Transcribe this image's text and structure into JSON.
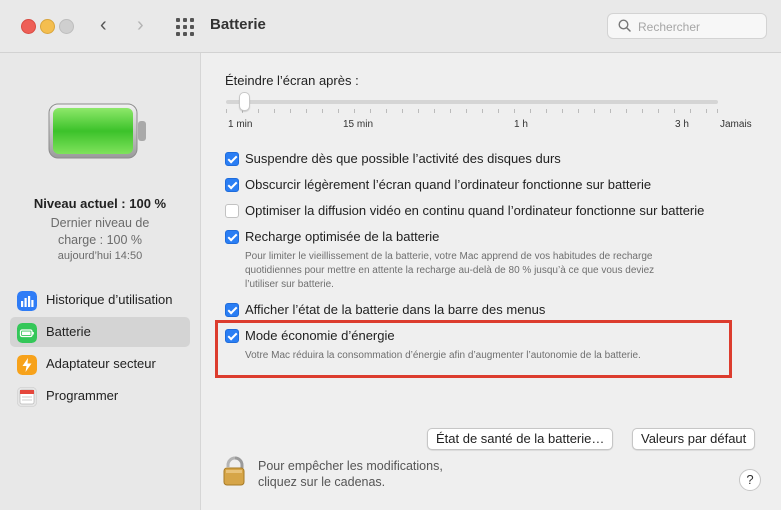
{
  "window": {
    "title": "Batterie"
  },
  "search": {
    "placeholder": "Rechercher"
  },
  "sidebar": {
    "level_main": "Niveau actuel : 100 %",
    "level_sub": "Dernier niveau de charge : 100 %",
    "level_time": "aujourd’hui 14:50",
    "items": [
      {
        "label": "Historique d’utilisation",
        "icon": "chart-icon",
        "color": "#2f7cf6"
      },
      {
        "label": "Batterie",
        "icon": "battery-icon",
        "color": "#34c759"
      },
      {
        "label": "Adaptateur secteur",
        "icon": "lightning-icon",
        "color": "#f7a21b"
      },
      {
        "label": "Programmer",
        "icon": "calendar-icon",
        "color": "#e5e5e5"
      }
    ],
    "selected": "Batterie"
  },
  "main": {
    "slider_label": "Éteindre l’écran après :",
    "slider_value": "1 min",
    "ticks": [
      "1 min",
      "15 min",
      "1 h",
      "3 h",
      "Jamais"
    ],
    "options": [
      {
        "label": "Suspendre dès que possible l’activité des disques durs",
        "checked": true
      },
      {
        "label": "Obscurcir légèrement l’écran quand l’ordinateur fonctionne sur batterie",
        "checked": true
      },
      {
        "label": "Optimiser la diffusion vidéo en continu quand l’ordinateur fonctionne sur batterie",
        "checked": false
      },
      {
        "label": "Recharge optimisée de la batterie",
        "checked": true,
        "description": [
          "Pour limiter le vieillissement de la batterie, votre Mac apprend de vos habitudes de recharge",
          "quotidiennes pour mettre en attente la recharge au-delà de 80 % jusqu’à ce que vous deviez",
          "l’utiliser sur batterie."
        ]
      },
      {
        "label": "Afficher l’état de la batterie dans la barre des menus",
        "checked": true
      },
      {
        "label": "Mode économie d’énergie",
        "checked": true,
        "description": [
          "Votre Mac réduira la consommation d’énergie afin d’augmenter l’autonomie de la batterie."
        ]
      }
    ],
    "buttons": {
      "health": "État de santé de la batterie…",
      "defaults": "Valeurs par défaut"
    },
    "lock_text": [
      "Pour empêcher les modifications,",
      "cliquez sur le cadenas."
    ],
    "help": "?",
    "highlight_color": "#dc3c2e"
  }
}
